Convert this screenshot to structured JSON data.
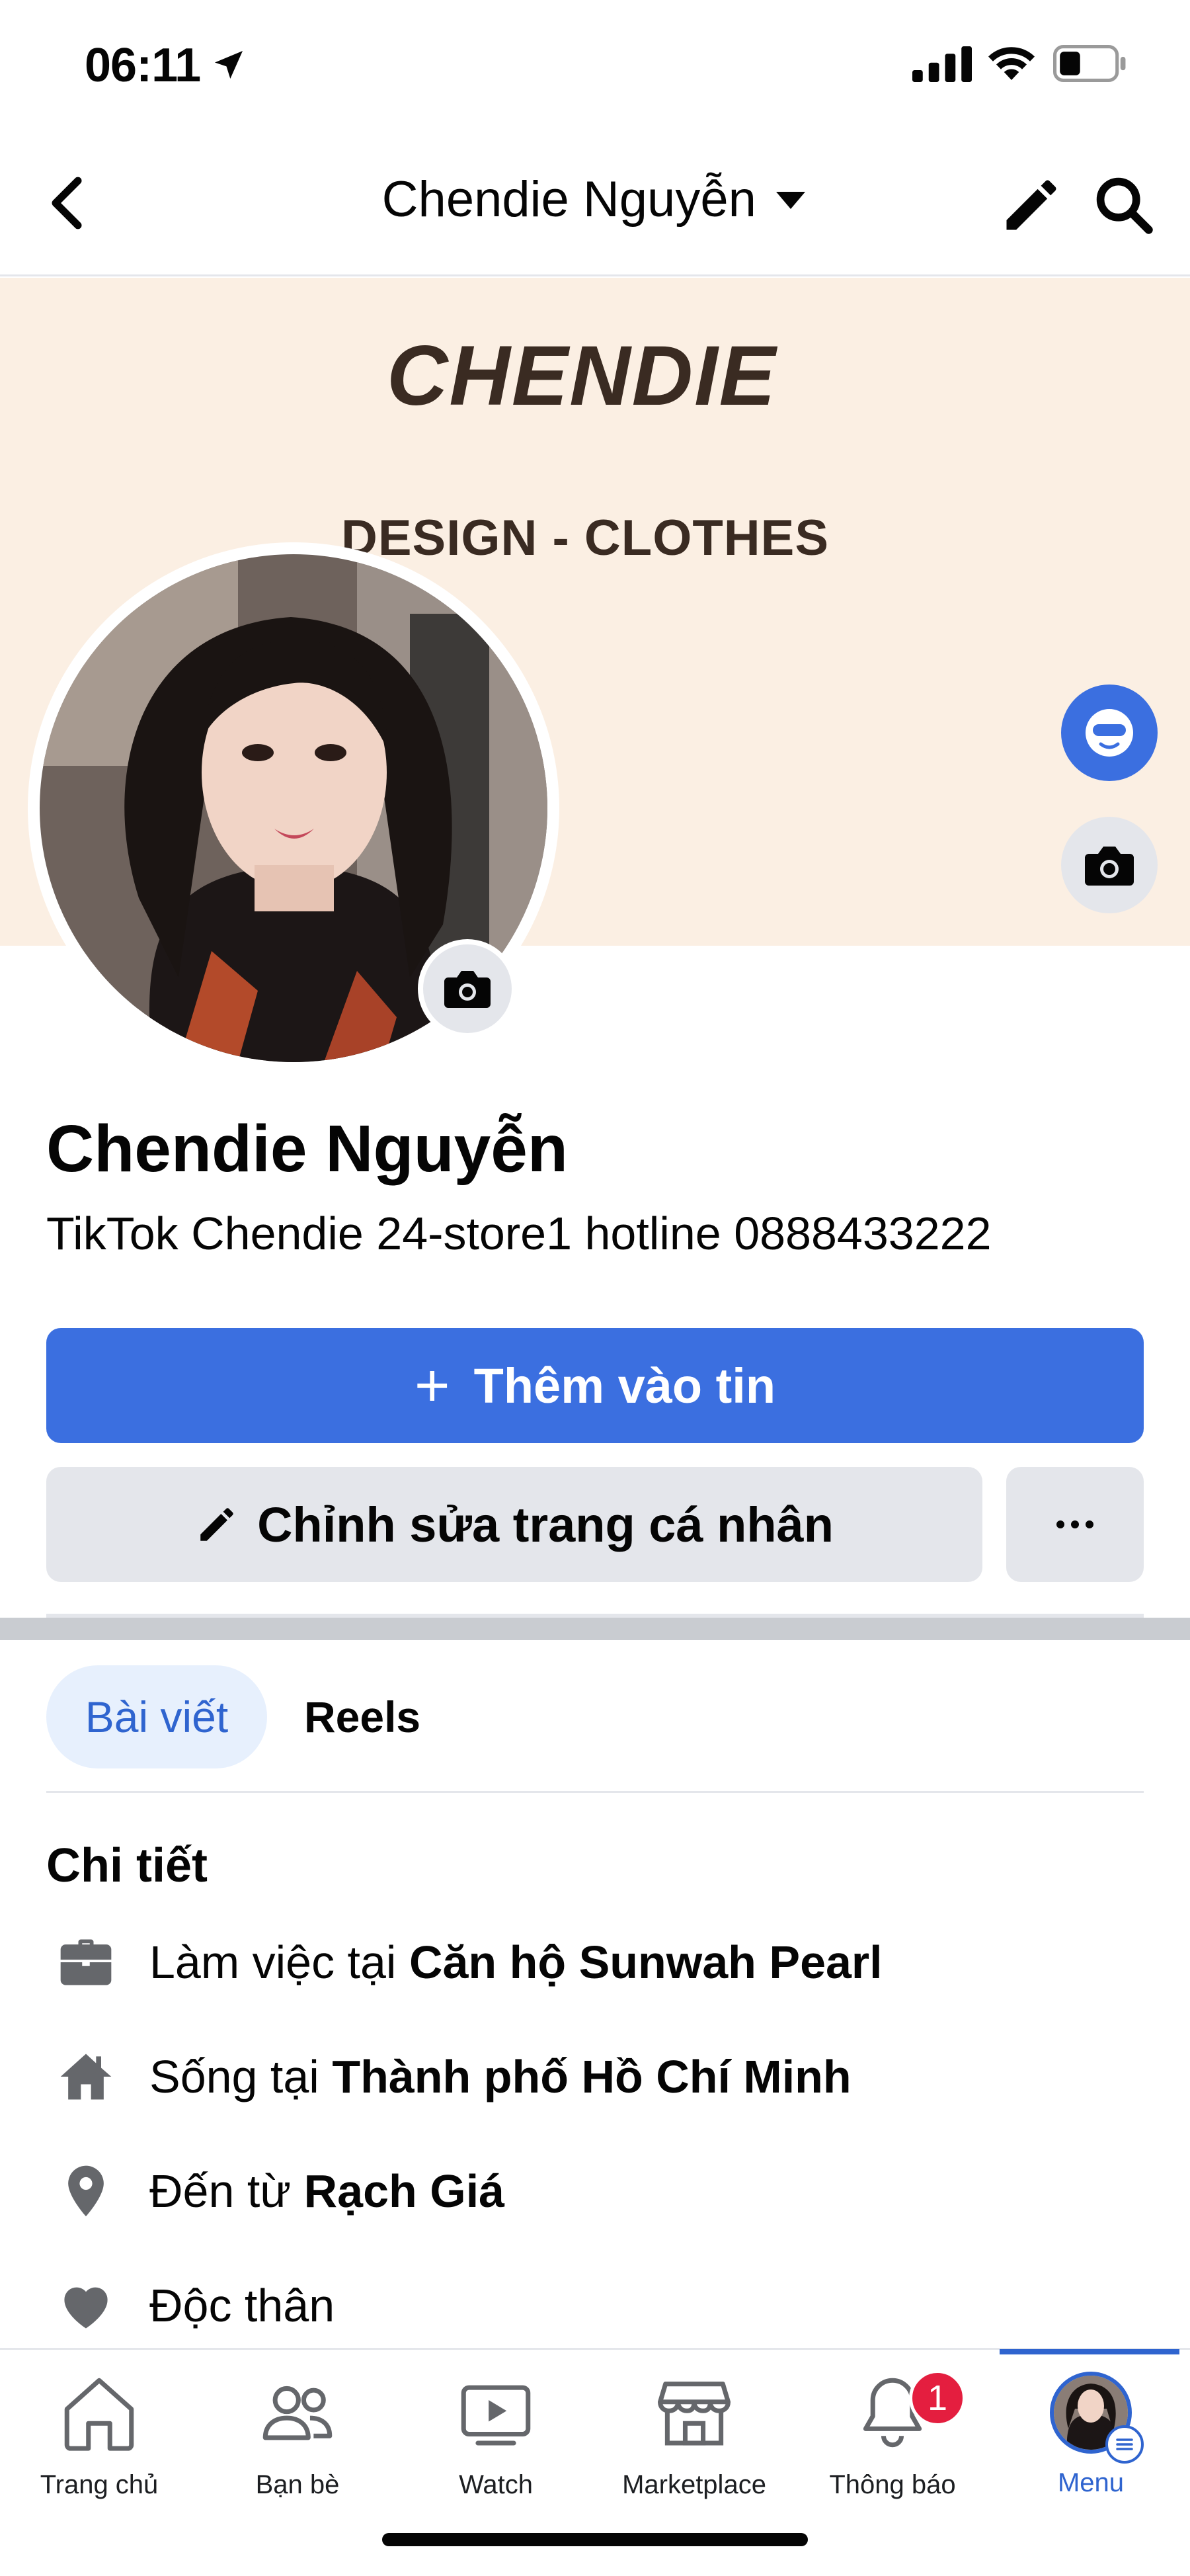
{
  "status_bar": {
    "time": "06:11"
  },
  "header": {
    "title": "Chendie Nguyễn"
  },
  "cover": {
    "brand": "CHENDIE",
    "subtitle": "DESIGN - CLOTHES"
  },
  "profile": {
    "name": "Chendie Nguyễn",
    "bio": "TikTok Chendie 24-store1  hotline 0888433222"
  },
  "actions": {
    "add_story_plus": "+",
    "add_story_label": "Thêm vào tin",
    "edit_profile_label": "Chỉnh sửa trang cá nhân"
  },
  "tabs": [
    {
      "label": "Bài viết",
      "active": true
    },
    {
      "label": "Reels",
      "active": false
    }
  ],
  "details": {
    "heading": "Chi tiết",
    "items": [
      {
        "icon": "briefcase-icon",
        "prefix": "Làm việc tại ",
        "value": "Căn hộ Sunwah Pearl"
      },
      {
        "icon": "home-icon",
        "prefix": "Sống tại ",
        "value": "Thành phố Hồ Chí Minh"
      },
      {
        "icon": "location-pin-icon",
        "prefix": "Đến từ ",
        "value": "Rạch Giá"
      },
      {
        "icon": "heart-icon",
        "prefix": "Độc thân",
        "value": ""
      }
    ]
  },
  "bottom_nav": [
    {
      "label": "Trang chủ",
      "icon": "home-icon"
    },
    {
      "label": "Bạn bè",
      "icon": "friends-icon"
    },
    {
      "label": "Watch",
      "icon": "watch-icon"
    },
    {
      "label": "Marketplace",
      "icon": "marketplace-icon"
    },
    {
      "label": "Thông báo",
      "icon": "bell-icon",
      "badge": "1"
    },
    {
      "label": "Menu",
      "icon": "menu-avatar",
      "active": true
    }
  ],
  "colors": {
    "accent": "#3b6fe0",
    "active_text": "#2f64cf",
    "cover_bg": "#fbefe3",
    "badge": "#e41e3f"
  }
}
